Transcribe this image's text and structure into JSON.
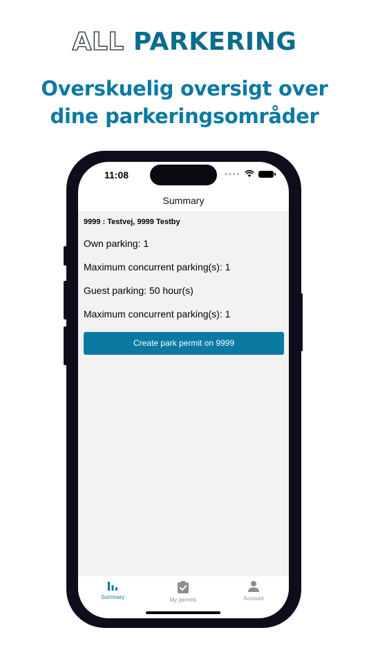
{
  "brand": {
    "outline_text": "ALL",
    "fill_text": "PARKERING"
  },
  "headline": {
    "line1": "Overskuelig oversigt over",
    "line2": "dine parkeringsområder"
  },
  "status_bar": {
    "time": "11:08"
  },
  "nav": {
    "title": "Summary"
  },
  "summary": {
    "address": "9999 : Testvej, 9999 Testby",
    "own_parking": "Own parking: 1",
    "own_max_concurrent": "Maximum concurrent parking(s): 1",
    "guest_parking": "Guest parking: 50 hour(s)",
    "guest_max_concurrent": "Maximum concurrent parking(s): 1",
    "create_permit_label": "Create park permit on 9999"
  },
  "tabs": [
    {
      "label": "Summary",
      "icon": "bar-chart-icon",
      "active": true
    },
    {
      "label": "My permits",
      "icon": "clipboard-check-icon",
      "active": false
    },
    {
      "label": "Account",
      "icon": "person-icon",
      "active": false
    }
  ],
  "colors": {
    "brand_blue": "#0b7aa3",
    "brand_dark_blue": "#0b6c8f",
    "content_bg": "#f2f2f2",
    "phone_frame": "#0f0c1c"
  }
}
